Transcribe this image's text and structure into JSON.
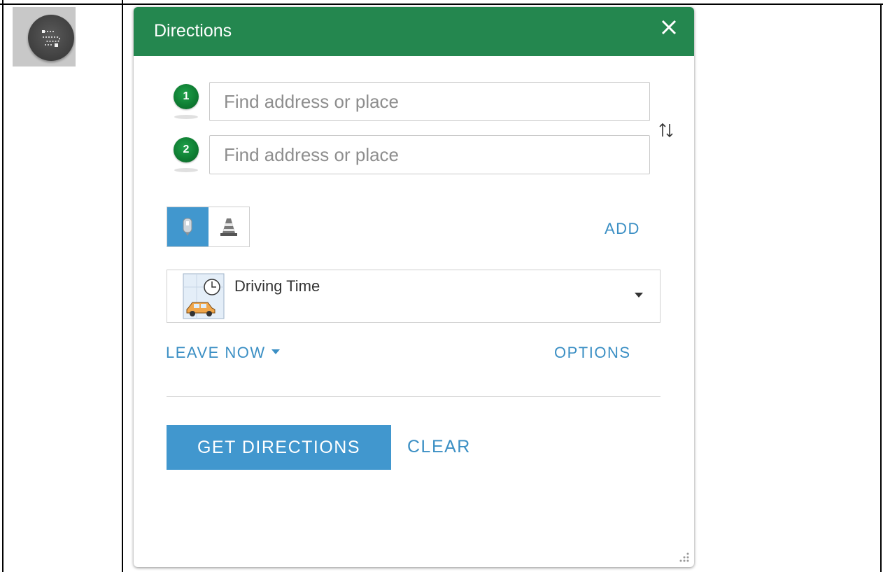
{
  "panel": {
    "title": "Directions"
  },
  "stops": [
    {
      "number": "1",
      "placeholder": "Find address or place"
    },
    {
      "number": "2",
      "placeholder": "Find address or place"
    }
  ],
  "actions": {
    "add_label": "ADD",
    "leave_now_label": "LEAVE NOW",
    "options_label": "OPTIONS",
    "get_directions_label": "GET DIRECTIONS",
    "clear_label": "CLEAR"
  },
  "travel_mode": {
    "selected": "Driving Time",
    "toggles": [
      {
        "name": "stops-mode",
        "icon": "map-pin-icon",
        "active": true
      },
      {
        "name": "barriers-mode",
        "icon": "traffic-cone-icon",
        "active": false
      }
    ]
  },
  "colors": {
    "header": "#24874f",
    "accent": "#4197ce",
    "link": "#3b8fc4",
    "stop_badge": "#0f7e33"
  },
  "icons": {
    "widget": "directions-widget-icon",
    "close": "close-icon",
    "swap": "swap-arrows-icon",
    "dropdown": "chevron-down-icon",
    "mode": "driving-time-icon",
    "resize": "resize-handle-icon"
  }
}
